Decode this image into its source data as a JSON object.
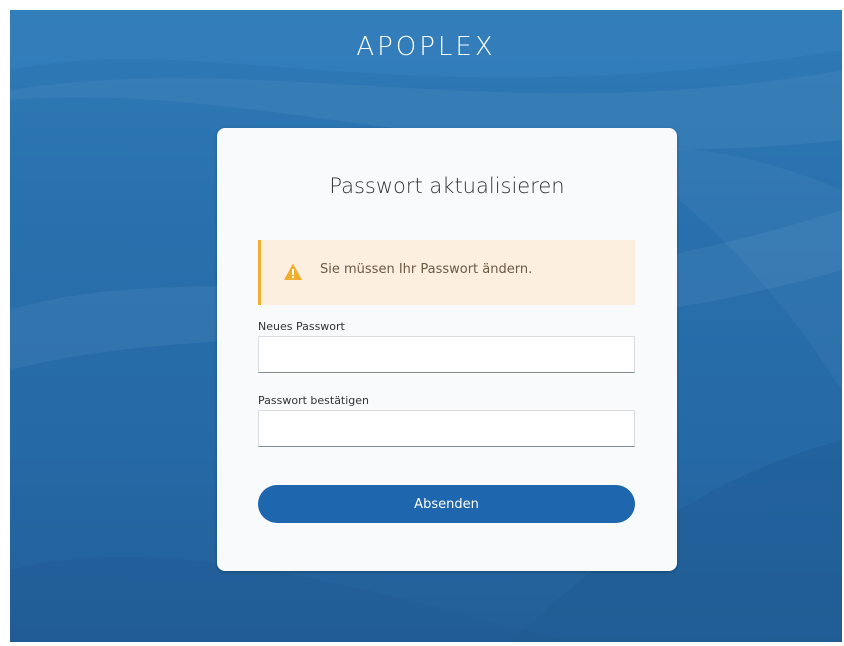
{
  "brand": {
    "name": "APOPLEX"
  },
  "form": {
    "title": "Passwort aktualisieren",
    "alert": {
      "type": "warning",
      "icon": "warning-triangle-icon",
      "message": "Sie müssen Ihr Passwort ändern."
    },
    "new_password": {
      "label": "Neues Passwort",
      "value": "",
      "placeholder": ""
    },
    "confirm_password": {
      "label": "Passwort bestätigen",
      "value": "",
      "placeholder": ""
    },
    "submit_label": "Absenden"
  },
  "colors": {
    "background": "#2870ad",
    "accent": "#1e66ad",
    "warning": "#f0ad2e",
    "warning_bg": "#fcefe0",
    "card": "#f8fafc"
  }
}
